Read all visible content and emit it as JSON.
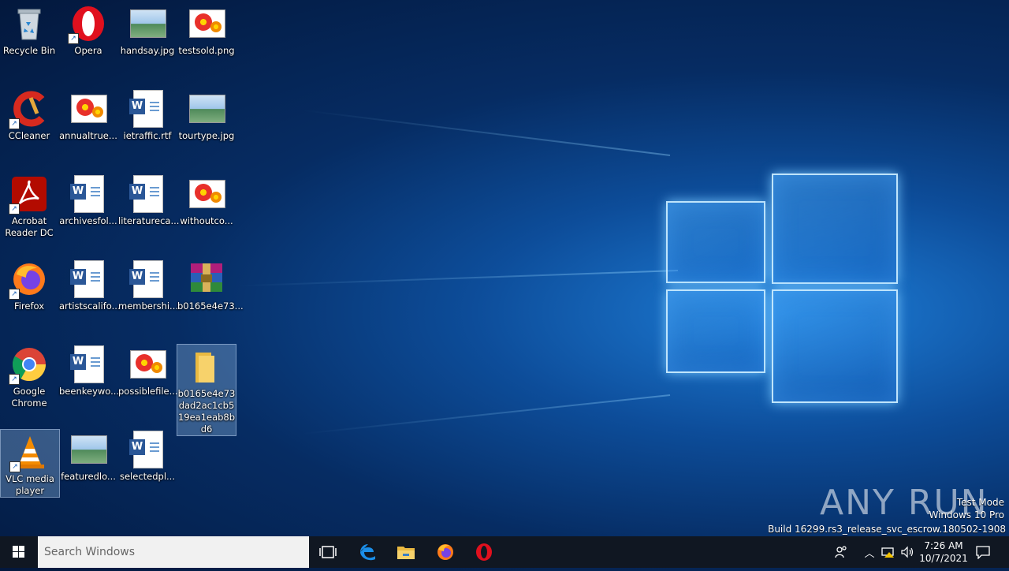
{
  "desktop": {
    "icons": [
      {
        "label": "Recycle Bin",
        "icon": "recycle-bin-icon"
      },
      {
        "label": "Opera",
        "icon": "opera-icon"
      },
      {
        "label": "handsay.jpg",
        "icon": "image-file-icon"
      },
      {
        "label": "testsold.png",
        "icon": "image-file-icon"
      },
      {
        "label": "CCleaner",
        "icon": "ccleaner-icon"
      },
      {
        "label": "annualtrue...",
        "icon": "image-file-icon"
      },
      {
        "label": "ietraffic.rtf",
        "icon": "word-document-icon"
      },
      {
        "label": "tourtype.jpg",
        "icon": "image-file-icon"
      },
      {
        "label": "Acrobat Reader DC",
        "icon": "acrobat-icon"
      },
      {
        "label": "archivesfol...",
        "icon": "word-document-icon"
      },
      {
        "label": "literatureca...",
        "icon": "word-document-icon"
      },
      {
        "label": "withoutco...",
        "icon": "image-file-icon"
      },
      {
        "label": "Firefox",
        "icon": "firefox-icon"
      },
      {
        "label": "artistscalifo...",
        "icon": "word-document-icon"
      },
      {
        "label": "membershi...",
        "icon": "word-document-icon"
      },
      {
        "label": "b0165e4e73...",
        "icon": "winrar-archive-icon"
      },
      {
        "label": "Google Chrome",
        "icon": "chrome-icon"
      },
      {
        "label": "beenkeywo...",
        "icon": "word-document-icon"
      },
      {
        "label": "possiblefile...",
        "icon": "image-file-icon"
      },
      {
        "label": "b0165e4e73dad2ac1cb519ea1eab8bd6",
        "icon": "folder-icon"
      },
      {
        "label": "VLC media player",
        "icon": "vlc-icon"
      },
      {
        "label": "featuredlo...",
        "icon": "image-file-icon"
      },
      {
        "label": "selectedpl...",
        "icon": "word-document-icon"
      }
    ]
  },
  "taskbar": {
    "search_placeholder": "Search Windows",
    "clock_time": "7:26 AM",
    "clock_date": "10/7/2021"
  },
  "watermark": {
    "brand": "ANY RUN",
    "line1": "Test Mode",
    "line2": "Windows 10 Pro",
    "line3": "Build 16299.rs3_release_svc_escrow.180502-1908"
  },
  "colors": {
    "taskbar": "#101722",
    "selection": "#96bee6"
  }
}
